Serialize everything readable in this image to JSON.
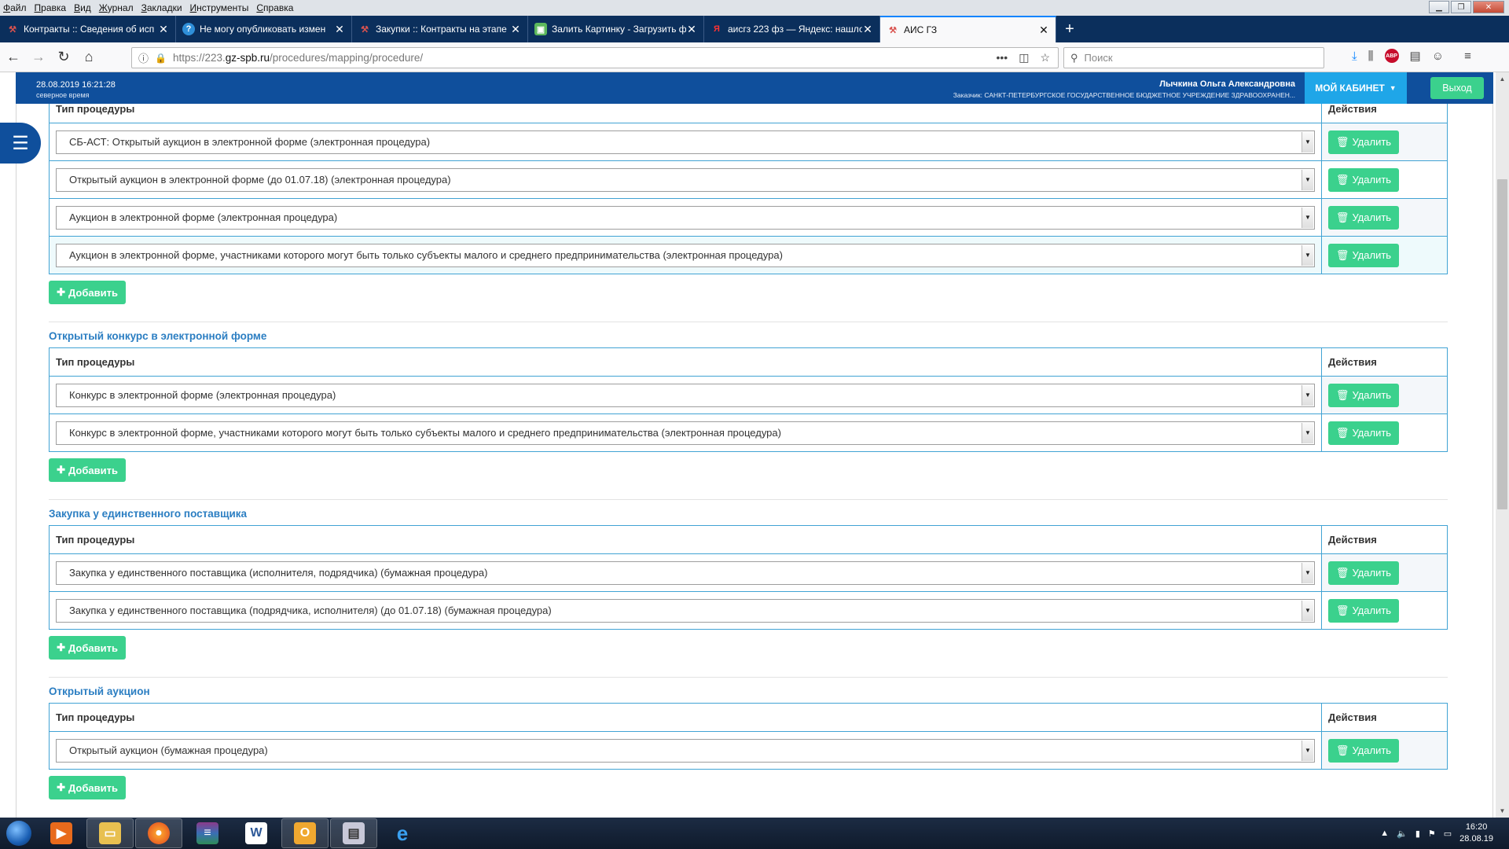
{
  "browser": {
    "menu": [
      "Файл",
      "Правка",
      "Вид",
      "Журнал",
      "Закладки",
      "Инструменты",
      "Справка"
    ],
    "tabs": [
      {
        "title": "Контракты :: Сведения об исп",
        "icon": "hammer-icon"
      },
      {
        "title": "Не могу опубликовать измен",
        "icon": "globe-icon"
      },
      {
        "title": "Закупки :: Контракты на этапе",
        "icon": "hammer-icon"
      },
      {
        "title": "Залить Картинку - Загрузить ф",
        "icon": "image-icon"
      },
      {
        "title": "аисгз 223 фз — Яндекс: нашлос",
        "icon": "yandex-icon"
      },
      {
        "title": "АИС ГЗ",
        "icon": "hammer-icon"
      }
    ],
    "url_prefix": "https://223.",
    "url_domain": "gz-spb.ru",
    "url_path": "/procedures/mapping/procedure/",
    "search_placeholder": "Поиск",
    "url_dots": "•••"
  },
  "header": {
    "datetime": "28.08.2019 16:21:28",
    "timezone": "северное время",
    "user_name": "Лычкина Ольга Александровна",
    "customer": "Заказчик: САНКТ-ПЕТЕРБУРГСКОЕ ГОСУДАРСТВЕННОЕ БЮДЖЕТНОЕ УЧРЕЖДЕНИЕ ЗДРАВООХРАНЕН...",
    "cabinet_label": "МОЙ КАБИНЕТ",
    "logout_label": "Выход"
  },
  "labels": {
    "col_type": "Тип процедуры",
    "col_actions": "Действия",
    "delete": "Удалить",
    "add": "Добавить"
  },
  "sections": [
    {
      "title": "",
      "rows": [
        "СБ-АСТ: Открытый аукцион в электронной форме (электронная процедура)",
        "Открытый аукцион в электронной форме (до 01.07.18) (электронная процедура)",
        "Аукцион в электронной форме (электронная процедура)",
        "Аукцион в электронной форме, участниками которого могут быть только субъекты малого и среднего предпринимательства (электронная процедура)"
      ]
    },
    {
      "title": "Открытый конкурс в электронной форме",
      "rows": [
        "Конкурс в электронной форме (электронная процедура)",
        "Конкурс в электронной форме, участниками которого могут быть только субъекты малого и среднего предпринимательства (электронная процедура)"
      ]
    },
    {
      "title": "Закупка у единственного поставщика",
      "rows": [
        "Закупка у единственного поставщика (исполнителя, подрядчика) (бумажная процедура)",
        "Закупка у единственного поставщика (подрядчика, исполнителя) (до 01.07.18) (бумажная процедура)"
      ]
    },
    {
      "title": "Открытый аукцион",
      "rows": [
        "Открытый аукцион (бумажная процедура)"
      ]
    }
  ],
  "taskbar": {
    "time": "16:20",
    "date": "28.08.19"
  },
  "colors": {
    "header_blue": "#0f4f9c",
    "cabinet_blue": "#1fa6e8",
    "green_button": "#3bd18d",
    "table_border": "#41a3d4",
    "section_title": "#2b7ec2"
  }
}
